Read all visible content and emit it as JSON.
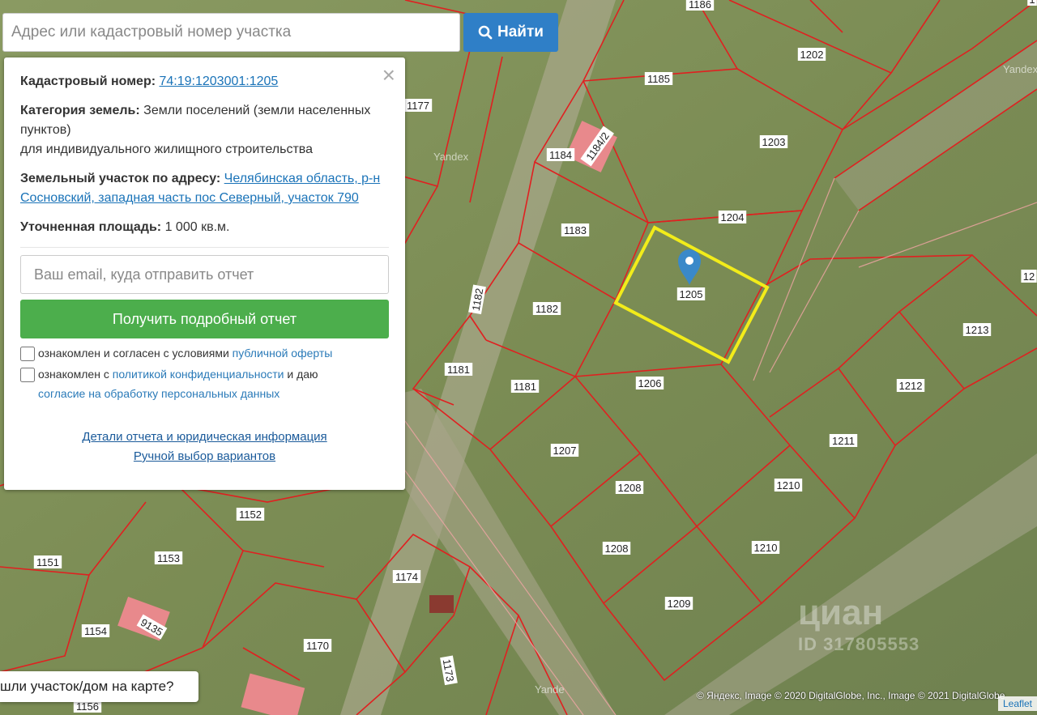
{
  "search": {
    "placeholder": "Адрес или кадастровый номер участка",
    "button_label": "Найти"
  },
  "panel": {
    "cadastral_label": "Кадастровый номер:",
    "cadastral_number": "74:19:1203001:1205",
    "category_label": "Категория земель:",
    "category_value_1": "Земли поселений (земли населенных пунктов)",
    "category_value_2": "для индивидуального жилищного строительства",
    "address_label": "Земельный участок по адресу:",
    "address_value": "Челябинская область, р-н Сосновский, западная часть пос Северный, участок 790",
    "area_label": "Уточненная площадь:",
    "area_value": "1 000 кв.м.",
    "email_placeholder": "Ваш email, куда отправить отчет",
    "report_button": "Получить подробный отчет",
    "consent1_text": "ознакомлен и согласен с условиями",
    "consent1_link": "публичной оферты",
    "consent2_text_a": "ознакомлен с",
    "consent2_link_a": "политикой конфиденциальности",
    "consent2_text_b": "и даю",
    "consent2_link_b": "согласие на обработку персональных данных",
    "details_link": "Детали отчета и юридическая информация",
    "manual_link": "Ручной выбор вариантов"
  },
  "map": {
    "selected_plot": "1205",
    "plot_labels": [
      "1186",
      "1202",
      "1185",
      "1203",
      "1177",
      "1184",
      "1184/2",
      "1204",
      "1183",
      "1205",
      "1182",
      "1182",
      "1181",
      "1181",
      "1206",
      "1213",
      "1212",
      "1211",
      "1207",
      "1208",
      "1210",
      "1208",
      "1210",
      "1209",
      "1152",
      "1151",
      "1153",
      "1174",
      "1154",
      "9135",
      "1170",
      "1173",
      "1156",
      "12",
      "1"
    ],
    "bottom_prompt": "шли участок/дом на карте?",
    "yandex_labels": [
      "Yandex",
      "Yandex",
      "Yande"
    ],
    "attribution": "© Яндекс, Image © 2020 DigitalGlobe, Inc., Image © 2021 DigitalGlobe",
    "leaflet_label": "Leaflet",
    "watermark_brand": "циан",
    "watermark_id": "ID 317805553"
  },
  "colors": {
    "boundary": "#e02020",
    "selected": "#f2ec1a",
    "marker": "#3a89c9",
    "search_button": "#2f7fc7",
    "report_button": "#4cae4c"
  }
}
